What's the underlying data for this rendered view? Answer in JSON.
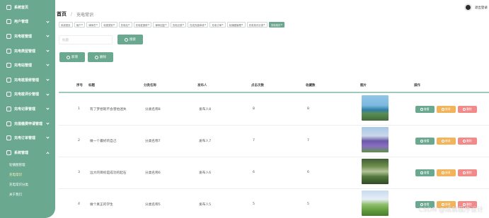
{
  "sidebar": {
    "items": [
      {
        "label": "系统首页",
        "expandable": false
      },
      {
        "label": "用户管理",
        "expandable": true
      },
      {
        "label": "充电桩管理",
        "expandable": true
      },
      {
        "label": "充电类型管理",
        "expandable": true
      },
      {
        "label": "充电站管理",
        "expandable": true
      },
      {
        "label": "充电桩报修管理",
        "expandable": true
      },
      {
        "label": "充电桩评价管理",
        "expandable": true
      },
      {
        "label": "充电记录管理",
        "expandable": true
      },
      {
        "label": "充值缴费申请管理",
        "expandable": true
      },
      {
        "label": "充电订单管理",
        "expandable": true
      },
      {
        "label": "系统管理",
        "expandable": true
      }
    ],
    "subitems": [
      {
        "label": "轮播图管理",
        "active": false
      },
      {
        "label": "充电常识",
        "active": true
      },
      {
        "label": "充电常识分类",
        "active": false
      },
      {
        "label": "关于我们",
        "active": false
      }
    ]
  },
  "header": {
    "home": "首页",
    "current": "充电常识"
  },
  "user": {
    "logout": "退出登录"
  },
  "tags": [
    "系统首页",
    "用户",
    "律师员",
    "电视类别",
    "充电站",
    "充电桩报修",
    "律师回复",
    "充电记录",
    "在线充值申请",
    "充电订单",
    "轮播图管理",
    "充电常识分类",
    "充电常识"
  ],
  "search": {
    "placeholder": "标题",
    "button": "搜索"
  },
  "actions": {
    "add": "新增",
    "delete": "删除"
  },
  "table": {
    "headers": [
      "序号",
      "标题",
      "分类名称",
      "发布人",
      "点击次数",
      "收藏数",
      "图片",
      "操作"
    ],
    "rows": [
      {
        "index": "1",
        "title": "有了梦想就不会害怕迷失",
        "category": "分类名称8",
        "publisher": "发布人8",
        "clicks": "8",
        "favorites": "8",
        "image": "coastal-rock-landscape"
      },
      {
        "index": "2",
        "title": "做一个最好的自己",
        "category": "分类名称7",
        "publisher": "发布人7",
        "clicks": "7",
        "favorites": "7",
        "image": "lavender-field"
      },
      {
        "index": "3",
        "title": "远大的目标是成功的起石",
        "category": "分类名称6",
        "publisher": "发布人6",
        "clicks": "6",
        "favorites": "6",
        "image": "stone-bridge-forest"
      },
      {
        "index": "4",
        "title": "做个真正的学生",
        "category": "分类名称5",
        "publisher": "发布人5",
        "clicks": "5",
        "favorites": "5",
        "image": "green-meadow-sky"
      }
    ],
    "ops": {
      "view": "查看",
      "edit": "修改",
      "delete": "删除"
    }
  },
  "watermark": "CSDN @成就程序设计",
  "colors": {
    "primary": "#6aa88f",
    "edit": "#f2b45b",
    "delete": "#f28a8a"
  }
}
